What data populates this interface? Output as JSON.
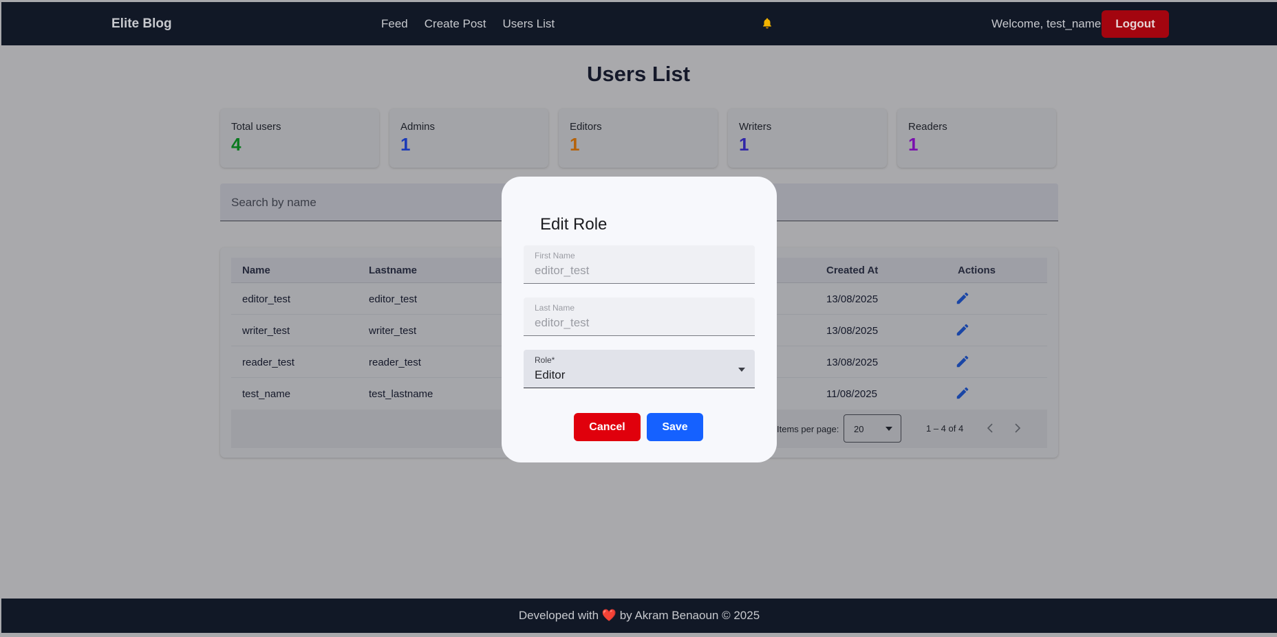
{
  "navbar": {
    "brand": "Elite Blog",
    "links": [
      "Feed",
      "Create Post",
      "Users List"
    ],
    "bell_icon": "bell-icon",
    "welcome": "Welcome, test_name",
    "logout_label": "Logout"
  },
  "page": {
    "title": "Users List"
  },
  "stats": [
    {
      "label": "Total users",
      "value": "4",
      "color": "#0a7a1f"
    },
    {
      "label": "Admins",
      "value": "1",
      "color": "#1a3ab8"
    },
    {
      "label": "Editors",
      "value": "1",
      "color": "#b5620a"
    },
    {
      "label": "Writers",
      "value": "1",
      "color": "#3026a8"
    },
    {
      "label": "Readers",
      "value": "1",
      "color": "#7a0fae"
    }
  ],
  "search": {
    "placeholder": "Search by name"
  },
  "table": {
    "headers": [
      "Name",
      "Lastname",
      "Created At",
      "Actions"
    ],
    "rows": [
      {
        "name": "editor_test",
        "lastname": "editor_test",
        "created_at": "13/08/2025"
      },
      {
        "name": "writer_test",
        "lastname": "writer_test",
        "created_at": "13/08/2025"
      },
      {
        "name": "reader_test",
        "lastname": "reader_test",
        "created_at": "13/08/2025"
      },
      {
        "name": "test_name",
        "lastname": "test_lastname",
        "created_at": "11/08/2025"
      }
    ],
    "action_icon": "pencil-icon",
    "paginator": {
      "items_per_page_label": "Items per page:",
      "items_per_page_value": "20",
      "range_label": "1 – 4 of 4"
    }
  },
  "modal": {
    "title": "Edit Role",
    "first_name_label": "First Name",
    "first_name_value": "editor_test",
    "last_name_label": "Last Name",
    "last_name_value": "editor_test",
    "role_label": "Role*",
    "role_value": "Editor",
    "cancel_label": "Cancel",
    "save_label": "Save"
  },
  "footer": {
    "text_before": "Developed with",
    "heart": "❤️",
    "text_after": "by Akram Benaoun © 2025"
  },
  "colors": {
    "navbar_bg": "#111826",
    "logout_bg": "#a3050f",
    "cancel_bg": "#e0000c",
    "save_bg": "#1561ff",
    "edit_icon": "#1a46a6"
  }
}
